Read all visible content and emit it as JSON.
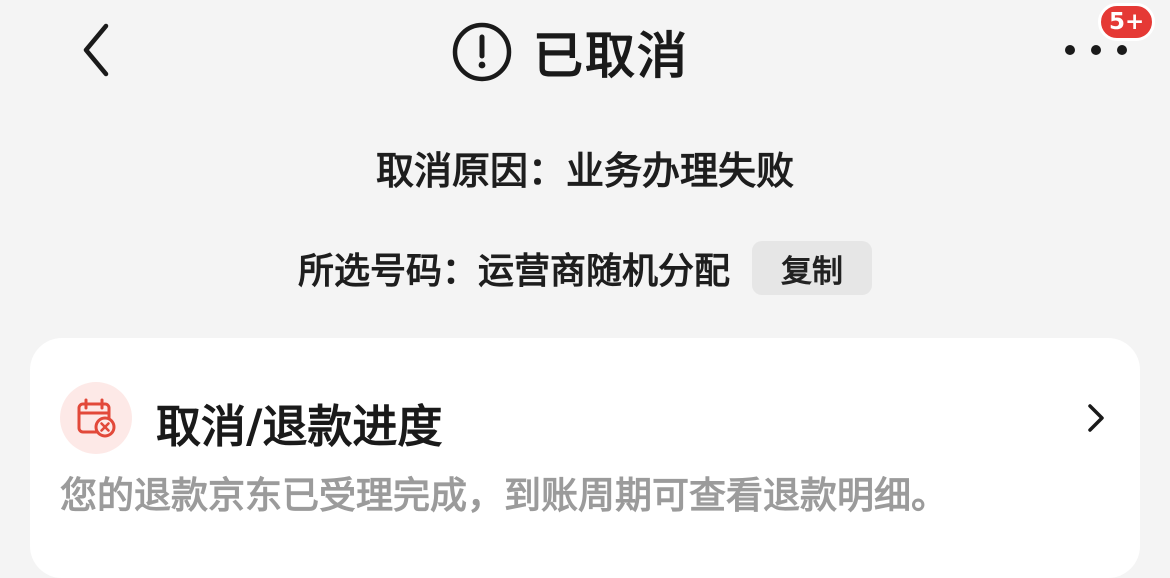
{
  "header": {
    "back_icon": "chevron-left-icon",
    "status_icon": "exclamation-circle-icon",
    "title": "已取消",
    "more_icon": "more-dots-icon",
    "badge": "5+"
  },
  "order": {
    "reason": "取消原因：业务办理失败",
    "number_text": "所选号码：运营商随机分配",
    "copy_label": "复制"
  },
  "card": {
    "icon": "calendar-cancel-icon",
    "title": "取消/退款进度",
    "description": "您的退款京东已受理完成，到账周期可查看退款明细。",
    "chevron_icon": "chevron-right-icon"
  },
  "colors": {
    "background": "#f4f4f4",
    "badge": "#e53935",
    "icon_accent": "#e2493a",
    "icon_bg": "#fde9e7",
    "muted_text": "#9b9b9b"
  }
}
